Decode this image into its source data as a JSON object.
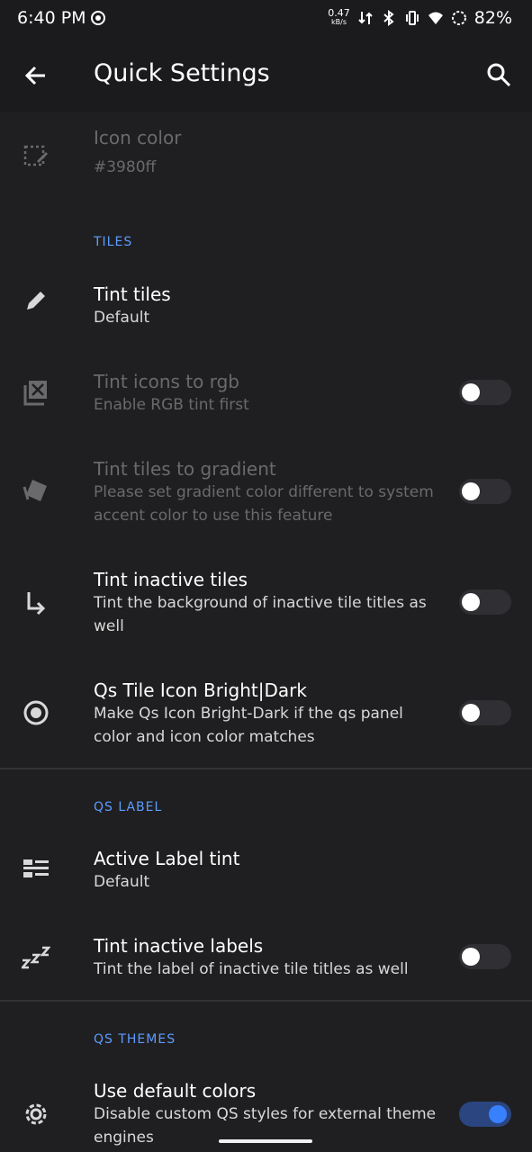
{
  "status": {
    "time": "6:40 PM",
    "net_speed": "0.47",
    "net_unit": "kB/s",
    "battery": "82%"
  },
  "appbar": {
    "title": "Quick Settings"
  },
  "rows": {
    "icon_color": {
      "title": "Icon color",
      "value": "#3980ff"
    },
    "tiles_header": "TILES",
    "tint_tiles": {
      "title": "Tint tiles",
      "summary": "Default"
    },
    "tint_icons_rgb": {
      "title": "Tint icons to rgb",
      "summary": "Enable RGB tint first"
    },
    "tint_gradient": {
      "title": "Tint tiles to gradient",
      "summary": "Please set gradient color different to system accent color to use this feature"
    },
    "tint_inactive": {
      "title": "Tint inactive tiles",
      "summary": "Tint the background of inactive tile titles as well"
    },
    "qs_icon_bright": {
      "title": "Qs Tile Icon Bright|Dark",
      "summary": "Make Qs Icon Bright-Dark if the qs panel color and icon color matches"
    },
    "qs_label_header": "QS LABEL",
    "active_label": {
      "title": "Active Label tint",
      "summary": "Default"
    },
    "tint_inactive_labels": {
      "title": "Tint inactive labels",
      "summary": "Tint the label of inactive tile titles as well"
    },
    "qs_themes_header": "QS THEMES",
    "default_colors": {
      "title": "Use default colors",
      "summary": "Disable custom QS styles for external theme engines"
    }
  },
  "toggles": {
    "tint_icons_rgb": false,
    "tint_gradient": false,
    "tint_inactive": false,
    "qs_icon_bright": false,
    "tint_inactive_labels": false,
    "default_colors": true
  },
  "colors": {
    "accent": "#3980ff",
    "background": "#1f1f21",
    "header": "#5d9bff"
  }
}
